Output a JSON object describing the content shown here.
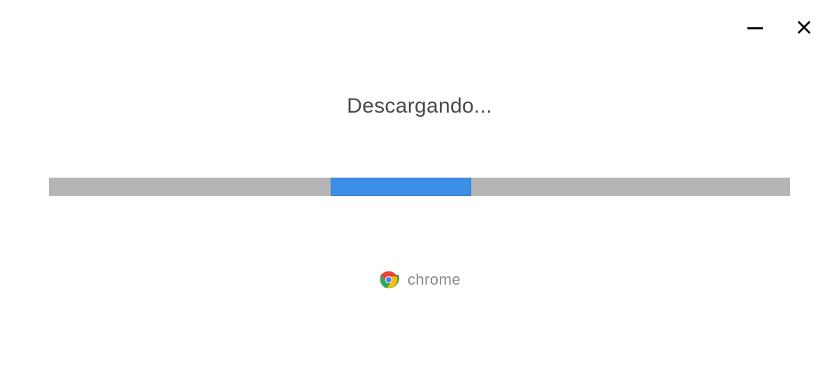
{
  "window": {
    "minimize_label": "Minimize",
    "close_label": "Close"
  },
  "installer": {
    "status_text": "Descargando...",
    "progress": {
      "indeterminate": true,
      "segment_start_percent": 38,
      "segment_width_percent": 19,
      "track_color": "#b5b5b5",
      "fill_color": "#3d8ee6"
    },
    "brand": {
      "icon": "chrome-logo",
      "label": "chrome"
    }
  }
}
